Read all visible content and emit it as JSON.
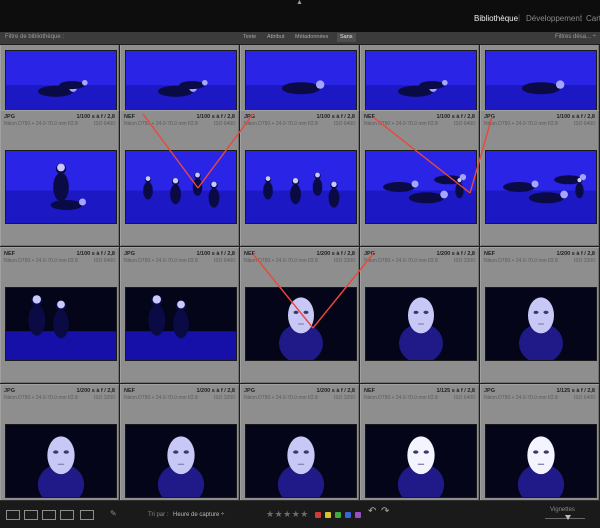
{
  "module_picker": {
    "collapse_glyph": "▲",
    "items": [
      {
        "label": "Bibliothèque",
        "active": true
      },
      {
        "label": "Développement",
        "active": false
      },
      {
        "label": "Cart",
        "active": false
      }
    ],
    "separator": "|"
  },
  "filter_bar": {
    "title": "Filtre de bibliothèque :",
    "tabs": [
      {
        "label": "Texte",
        "active": false
      },
      {
        "label": "Attribut",
        "active": false
      },
      {
        "label": "Métadonnées",
        "active": false
      },
      {
        "label": "Sans",
        "active": true
      }
    ],
    "filters_label": "Filtres désa... ÷"
  },
  "grid": {
    "cells": [
      {
        "format": "",
        "exposure": "",
        "lens": "",
        "iso": "",
        "photo": "dancer-floor-b"
      },
      {
        "format": "",
        "exposure": "",
        "lens": "",
        "iso": "",
        "photo": "dancer-floor-b"
      },
      {
        "format": "",
        "exposure": "",
        "lens": "",
        "iso": "",
        "photo": "dancer-floor-c"
      },
      {
        "format": "",
        "exposure": "",
        "lens": "",
        "iso": "",
        "photo": "dancer-floor-b"
      },
      {
        "format": "",
        "exposure": "",
        "lens": "",
        "iso": "",
        "photo": "dancer-floor-c"
      },
      {
        "format": "JPG",
        "exposure": "1/100 s à f / 2,8",
        "lens": "Nikon D750 + 24.0-70.0 mm f/2.8",
        "iso": "ISO 6400",
        "photo": "dancer-sitting"
      },
      {
        "format": "NEF",
        "exposure": "1/100 s à f / 2,8",
        "lens": "Nikon D750 + 24.0-70.0 mm f/2.8",
        "iso": "ISO 6400",
        "photo": "dancers-group"
      },
      {
        "format": "JPG",
        "exposure": "1/100 s à f / 2,8",
        "lens": "Nikon D750 + 24.0-70.0 mm f/2.8",
        "iso": "ISO 6400",
        "photo": "dancers-group"
      },
      {
        "format": "NEF",
        "exposure": "1/100 s à f / 2,8",
        "lens": "Nikon D750 + 24.0-70.0 mm f/2.8",
        "iso": "ISO 6400",
        "photo": "dancers-floor-a"
      },
      {
        "format": "JPG",
        "exposure": "1/100 s à f / 2,8",
        "lens": "Nikon D750 + 24.0-70.0 mm f/2.8",
        "iso": "ISO 6400",
        "photo": "dancers-floor-a"
      },
      {
        "format": "NEF",
        "exposure": "1/100 s à f / 2,8",
        "lens": "Nikon D750 + 24.0-70.0 mm f/2.8",
        "iso": "ISO 6400",
        "photo": "dancers-standing"
      },
      {
        "format": "JPG",
        "exposure": "1/100 s à f / 2,8",
        "lens": "Nikon D750 + 24.0-70.0 mm f/2.8",
        "iso": "ISO 6400",
        "photo": "dancers-standing"
      },
      {
        "format": "NEF",
        "exposure": "1/200 s à f / 2,8",
        "lens": "Nikon D750 + 24.0-70.0 mm f/2.8",
        "iso": "ISO 3200",
        "photo": "mask"
      },
      {
        "format": "JPG",
        "exposure": "1/200 s à f / 2,8",
        "lens": "Nikon D750 + 24.0-70.0 mm f/2.8",
        "iso": "ISO 3200",
        "photo": "mask"
      },
      {
        "format": "NEF",
        "exposure": "1/200 s à f / 2,8",
        "lens": "Nikon D750 + 24.0-70.0 mm f/2.8",
        "iso": "ISO 3200",
        "photo": "mask"
      },
      {
        "format": "JPG",
        "exposure": "1/200 s à f / 2,8",
        "lens": "Nikon D750 + 24.0-70.0 mm f/2.8",
        "iso": "ISO 3200",
        "photo": "mask-closeup"
      },
      {
        "format": "NEF",
        "exposure": "1/200 s à f / 2,8",
        "lens": "Nikon D750 + 24.0-70.0 mm f/2.8",
        "iso": "ISO 3200",
        "photo": "mask-closeup"
      },
      {
        "format": "JPG",
        "exposure": "1/200 s à f / 2,8",
        "lens": "Nikon D750 + 24.0-70.0 mm f/2.8",
        "iso": "ISO 3200",
        "photo": "mask-closeup"
      },
      {
        "format": "NEF",
        "exposure": "1/125 s à f / 2,8",
        "lens": "Nikon D750 + 24.0-70.0 mm f/2.8",
        "iso": "ISO 6400",
        "photo": "mask-bright"
      },
      {
        "format": "JPG",
        "exposure": "1/125 s à f / 2,8",
        "lens": "Nikon D750 + 24.0-70.0 mm f/2.8",
        "iso": "ISO 6400",
        "photo": "mask-bright"
      }
    ]
  },
  "toolbar": {
    "view_icons": [
      "grid-view-icon",
      "loupe-view-icon",
      "compare-view-icon",
      "survey-view-icon",
      "people-view-icon"
    ],
    "painter_glyph": "✎",
    "sort_label": "Tri par :",
    "sort_value": "Heure de capture ÷",
    "stars": "★★★★★",
    "color_labels": [
      "#d23a3a",
      "#d8c232",
      "#3faa3f",
      "#3a63d8",
      "#9a4fc6"
    ],
    "rotate_left_glyph": "↶",
    "rotate_right_glyph": "↷",
    "thumbnail_label": "Vignettes"
  },
  "colors": {
    "annotation_line": "#e8493a",
    "cell_bg": "#8e8e8e",
    "stage_blue": "#2a25e6"
  }
}
